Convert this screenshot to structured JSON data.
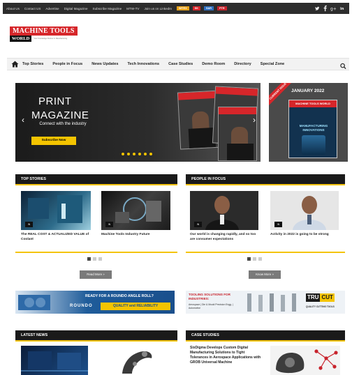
{
  "topbar": {
    "links": [
      "About Us",
      "Contact US",
      "Advertise",
      "Digital Magazine",
      "Subscribe Magazine",
      "MTW-TV",
      "Join us on LinkedIn"
    ],
    "chips": [
      {
        "label": "IMTEX",
        "color": "#e8a21a"
      },
      {
        "label": "SK",
        "color": "#d6262a"
      },
      {
        "label": "SAR",
        "color": "#2f6fbf"
      },
      {
        "label": "PTR",
        "color": "#c8232c"
      }
    ],
    "social_icons": [
      "twitter-icon",
      "facebook-icon",
      "google-plus-icon",
      "linkedin-icon"
    ]
  },
  "logo": {
    "top": "MACHINE TOOLS",
    "bottom": "WORLD",
    "tagline": "Your Knowledge Partner in Manufacturing"
  },
  "nav": {
    "items": [
      "Top Stories",
      "People in Focus",
      "News Updates",
      "Tech Innovations",
      "Case Studies",
      "Demo Room",
      "Directory",
      "Special Zone"
    ]
  },
  "banner": {
    "line1": "PRINT",
    "line2": "MAGAZINE",
    "subtitle": "Connect with the industry",
    "button": "Subscribe Now",
    "cover_brand": "MACHINE TOOLS WORLD"
  },
  "issue": {
    "ribbon": "CURRENT ISSUE",
    "date": "JANUARY 2022",
    "cover_brand": "MACHINE TOOLS WORLD",
    "cover_title": "MANUFACTURING INNOVATIONS"
  },
  "top_stories": {
    "heading": "TOP STORIES",
    "cards": [
      {
        "title": "The REAL COST & ACTUALIZED VALUE of Coolant",
        "badge": "IN"
      },
      {
        "title": "Machine Tools Industry Future",
        "badge": "IN"
      }
    ],
    "more_label": "Read More »"
  },
  "people": {
    "heading": "PEOPLE IN FOCUS",
    "cards": [
      {
        "title": "Our world is changing rapidly, and so too are consumer expectations",
        "badge": "IN"
      },
      {
        "title": "Activity in 2022 is going to be strong",
        "badge": "IN"
      }
    ],
    "more_label": "Know More »"
  },
  "ads": {
    "left": {
      "tagline": "READY FOR A ROUNDO ANGLE ROLL?",
      "brand": "ROUNDO",
      "slogan": "QUALITY and RELIABILITY"
    },
    "right": {
      "title": "TOOLING SOLUTIONS FOR INDUSTRIES:",
      "sectors": "Aerospace | Die & Mould Precision Engg. | Automotive",
      "brand_a": "TRU",
      "brand_b": "CUT",
      "slogan": "QUALITY CUTTING TOOLS"
    }
  },
  "latest_news": {
    "heading": "LATEST NEWS"
  },
  "case_studies": {
    "heading": "CASE STUDIES",
    "title": "SixDigma Develops Custom Digital Manufacturing Solutions to Tight Tolerances in Aerospace Applications with GROB Universal Machine"
  }
}
